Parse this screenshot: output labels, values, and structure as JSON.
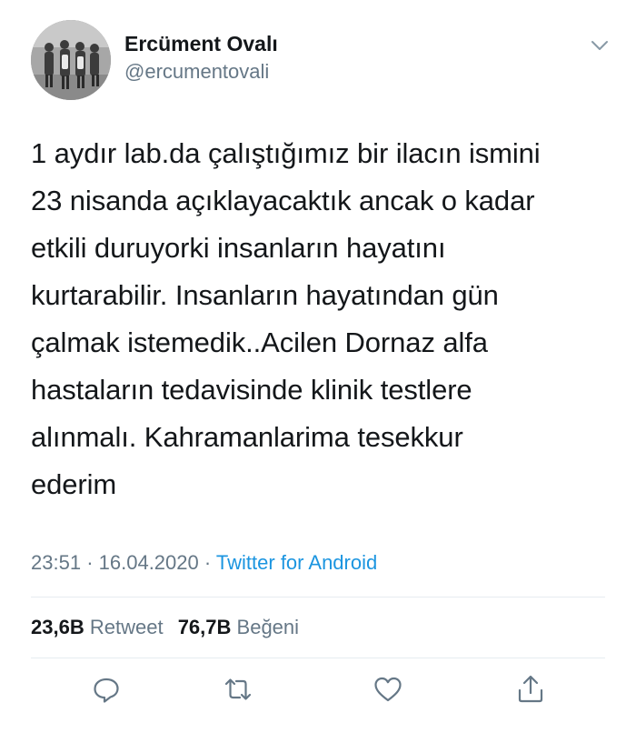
{
  "user": {
    "display_name": "Ercüment Ovalı",
    "handle": "@ercumentovali"
  },
  "tweet": {
    "text": "1 aydır lab.da çalıştığımız bir ilacın ismini\n23 nisanda açıklayacaktık ancak o kadar\netkili duruyorki insanların hayatını\nkurtarabilir.  Insanların hayatından gün\nçalmak istemedik..Acilen Dornaz alfa\nhastaların tedavisinde klinik testlere\nalınmalı. Kahramanlarima tesekkur\nederim",
    "time": "23:51",
    "date": "16.04.2020",
    "separator": "·",
    "source": "Twitter for Android"
  },
  "stats": {
    "retweets": "23,6B",
    "retweets_label": "Retweet",
    "likes": "76,7B",
    "likes_label": "Beğeni"
  },
  "icons": {
    "caret": "chevron-down-icon",
    "reply": "reply-icon",
    "retweet": "retweet-icon",
    "like": "heart-icon",
    "share": "share-icon"
  },
  "colors": {
    "text": "#14171a",
    "secondary": "#657786",
    "link": "#1b95e0",
    "divider": "#e6ecf0"
  }
}
